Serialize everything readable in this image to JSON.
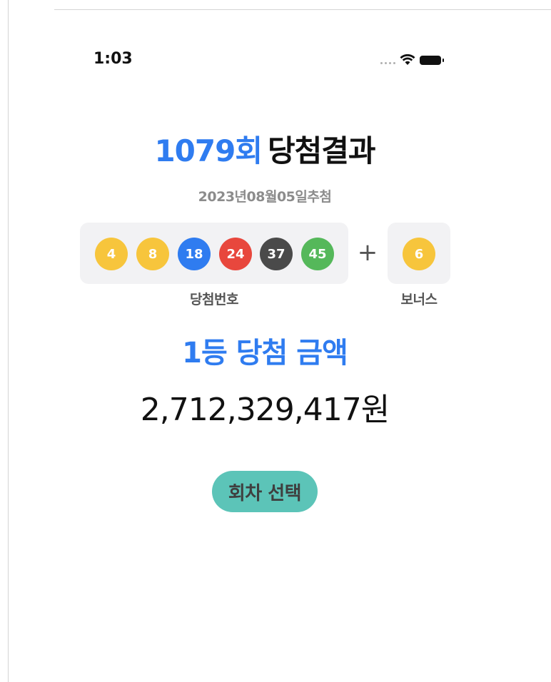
{
  "status_bar": {
    "time": "1:03",
    "icons": [
      "cellular-signal-icon",
      "wifi-icon",
      "battery-icon"
    ]
  },
  "header": {
    "round": "1079회",
    "label": "당첨결과"
  },
  "draw_date": "2023년08월05일추첨",
  "winning_numbers": {
    "balls": [
      {
        "number": "4",
        "color": "#f7c53c"
      },
      {
        "number": "8",
        "color": "#f7c53c"
      },
      {
        "number": "18",
        "color": "#2f7cf0"
      },
      {
        "number": "24",
        "color": "#e8473d"
      },
      {
        "number": "37",
        "color": "#4a4a4a"
      },
      {
        "number": "45",
        "color": "#55b85a"
      }
    ],
    "plus": "+",
    "caption": "당첨번호"
  },
  "bonus": {
    "number": "6",
    "color": "#f7c53c",
    "caption": "보너스"
  },
  "first_prize": {
    "label": "1등 당첨 금액",
    "amount": "2,712,329,417원"
  },
  "select_button": {
    "label": "회차 선택",
    "color": "#5cc4b8"
  },
  "accent_color": "#2f7cf0"
}
